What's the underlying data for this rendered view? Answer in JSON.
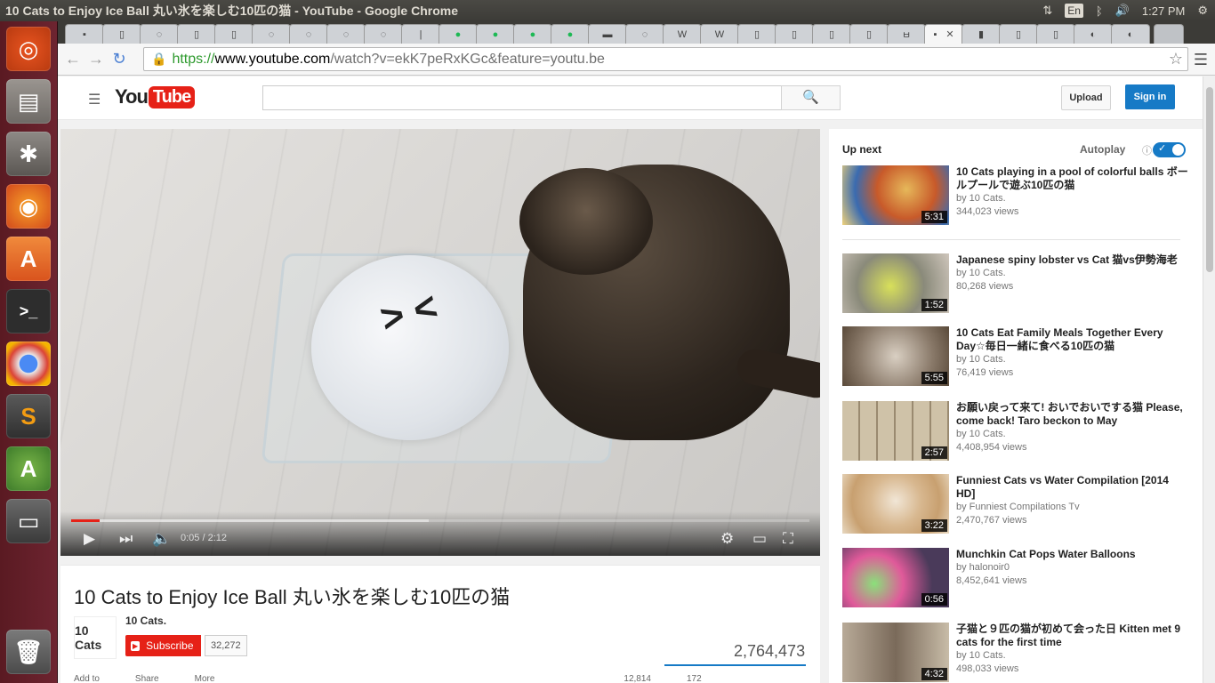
{
  "window": {
    "title": "10 Cats to Enjoy Ice Ball 丸い氷を楽しむ10匹の猫 - YouTube - Google Chrome",
    "language": "En",
    "clock": "1:27 PM"
  },
  "browser": {
    "url_secure": "https://",
    "url_host": "www.youtube.com",
    "url_path": "/watch?v=ekK7peRxKGc&feature=youtu.be"
  },
  "youtube": {
    "logo_you": "You",
    "logo_tube": "Tube",
    "search_placeholder": "",
    "upload_label": "Upload",
    "signin_label": "Sign in"
  },
  "player": {
    "current_time": "0:05",
    "duration": "2:12",
    "time_separator": " / ",
    "played_fraction": 0.038,
    "face_glyph": "> <"
  },
  "video": {
    "title": "10 Cats to Enjoy Ice Ball 丸い氷を楽しむ10匹の猫",
    "channel_name": "10 Cats.",
    "channel_avatar_text": "10 Cats",
    "subscribe_label": "Subscribe",
    "subscriber_count": "32,272",
    "view_count": "2,764,473",
    "actions": [
      "Add to",
      "Share",
      "More"
    ],
    "likes": "12,814",
    "dislikes": "172"
  },
  "sidebar": {
    "up_next_label": "Up next",
    "autoplay_label": "Autoplay",
    "videos": [
      {
        "title": "10 Cats playing in a pool of colorful balls ボールプールで遊ぶ10匹の猫",
        "channel": "by 10 Cats.",
        "views": "344,023 views",
        "duration": "5:31"
      },
      {
        "title": "Japanese spiny lobster vs Cat 猫vs伊勢海老",
        "channel": "by 10 Cats.",
        "views": "80,268 views",
        "duration": "1:52"
      },
      {
        "title": "10 Cats Eat Family Meals Together Every Day☆毎日一緒に食べる10匹の猫",
        "channel": "by 10 Cats.",
        "views": "76,419 views",
        "duration": "5:55"
      },
      {
        "title": "お願い戻って来て! おいでおいでする猫 Please, come back! Taro beckon to May",
        "channel": "by 10 Cats.",
        "views": "4,408,954 views",
        "duration": "2:57"
      },
      {
        "title": "Funniest Cats vs Water Compilation [2014 HD]",
        "channel": "by Funniest Compilations Tv",
        "views": "2,470,767 views",
        "duration": "3:22"
      },
      {
        "title": "Munchkin Cat Pops Water Balloons",
        "channel": "by halonoir0",
        "views": "8,452,641 views",
        "duration": "0:56"
      },
      {
        "title": "子猫と９匹の猫が初めて会った日 Kitten met 9 cats for the first time",
        "channel": "by 10 Cats.",
        "views": "498,033 views",
        "duration": "4:32"
      }
    ]
  },
  "colors": {
    "youtube_red": "#e62117",
    "youtube_blue": "#167ac6",
    "launcher": "#6d2430"
  }
}
